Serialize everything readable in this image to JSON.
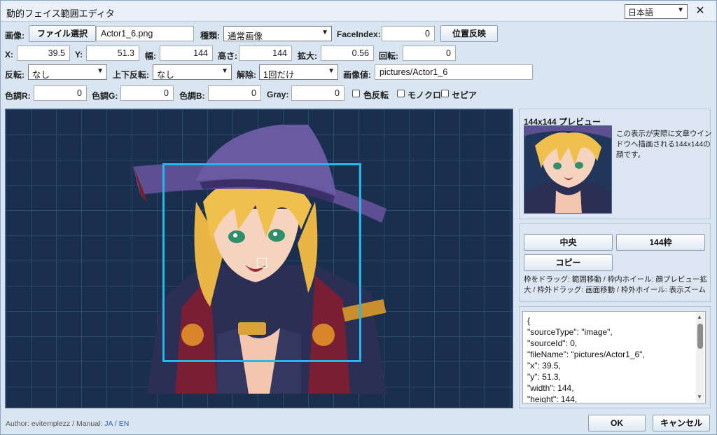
{
  "window": {
    "title": "動的フェイス範囲エディタ"
  },
  "language": {
    "selected": "日本語"
  },
  "row1": {
    "image_label": "画像:",
    "file_button": "ファイル選択",
    "file_value": "Actor1_6.png",
    "type_label": "種類:",
    "type_value": "通常画像",
    "faceindex_label": "FaceIndex:",
    "faceindex_value": "0",
    "apply_button": "位置反映"
  },
  "row2": {
    "x_label": "X:",
    "x_value": "39.5",
    "y_label": "Y:",
    "y_value": "51.3",
    "width_label": "幅:",
    "width_value": "144",
    "height_label": "高さ:",
    "height_value": "144",
    "scale_label": "拡大:",
    "scale_value": "0.56",
    "rotate_label": "回転:",
    "rotate_value": "0"
  },
  "row3": {
    "flip_label": "反転:",
    "flip_value": "なし",
    "vflip_label": "上下反転:",
    "vflip_value": "なし",
    "release_label": "解除:",
    "release_value": "1回だけ",
    "imgval_label": "画像値:",
    "imgval_value": "pictures/Actor1_6"
  },
  "row4": {
    "r_label": "色調R:",
    "r_value": "0",
    "g_label": "色調G:",
    "g_value": "0",
    "b_label": "色調B:",
    "b_value": "0",
    "gray_label": "Gray:",
    "gray_value": "0",
    "invert_label": "色反転",
    "mono_label": "モノクロ",
    "sepia_label": "セピア"
  },
  "preview": {
    "title": "144x144 プレビュー",
    "description": "この表示が実際に文章ウインドウへ描画される144x144の顔です。"
  },
  "actions": {
    "center_button": "中央",
    "frame144_button": "144枠",
    "copy_button": "コピー",
    "help": "枠をドラッグ: 範囲移動 / 枠内ホイール: 顔プレビュー拡大 / 枠外ドラッグ: 画面移動 / 枠外ホイール: 表示ズーム"
  },
  "json_lines": [
    "{",
    "  \"sourceType\": \"image\",",
    "  \"sourceId\": 0,",
    "  \"fileName\": \"pictures/Actor1_6\",",
    "  \"x\": 39.5,",
    "  \"y\": 51.3,",
    "  \"width\": 144,",
    "  \"height\": 144,"
  ],
  "footer": {
    "author": "Author: evitemplezz / Manual: ",
    "link_ja": "JA",
    "sep": " / ",
    "link_en": "EN",
    "ok_button": "OK",
    "cancel_button": "キャンセル"
  },
  "colors": {
    "canvas_bg": "#1a2f4d",
    "frame": "#26b7ea",
    "link": "#2b66b1"
  }
}
